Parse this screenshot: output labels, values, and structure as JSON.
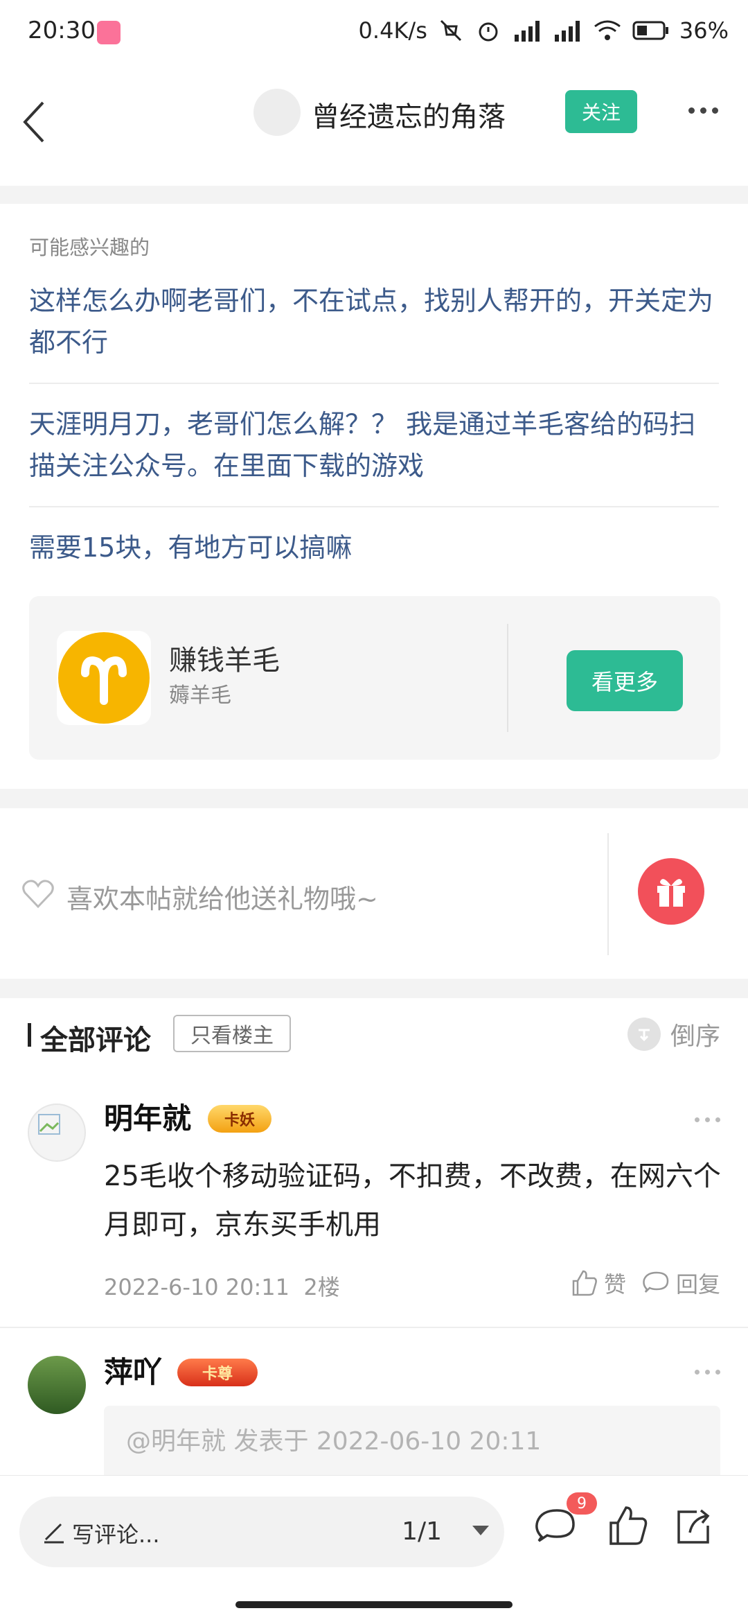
{
  "status_bar": {
    "time": "20:30",
    "net_speed": "0.4K/s",
    "battery": "36%",
    "icons": [
      "bilibili-app-icon",
      "mute-icon",
      "alarm-icon",
      "hd-signal-icon",
      "signal-icon",
      "wifi-icon",
      "battery-icon"
    ]
  },
  "header": {
    "title": "曾经遗忘的角落",
    "follow_label": "关注"
  },
  "interest": {
    "label": "可能感兴趣的",
    "items": [
      "这样怎么办啊老哥们，不在试点，找别人帮开的，开关定为都不行",
      "天涯明月刀，老哥们怎么解？？ 我是通过羊毛客给的码扫描关注公众号。在里面下载的游戏",
      "需要15块，有地方可以搞嘛"
    ],
    "game_card": {
      "name": "赚钱羊毛",
      "subtitle": "薅羊毛",
      "button": "看更多",
      "icon_color": "#f7b500"
    }
  },
  "gift": {
    "text": "喜欢本帖就给他送礼物哦~",
    "button_color": "#f2505a"
  },
  "comments_header": {
    "title": "全部评论",
    "filter": "只看楼主",
    "sort": "倒序"
  },
  "comments": [
    {
      "name": "明年就",
      "badge": "卡妖",
      "text": "25毛收个移动验证码，不扣费，不改费，在网六个月即可，京东买手机用",
      "date": "2022-6-10 20:11",
      "floor": "2楼",
      "like_label": "赞",
      "reply_label": "回复"
    },
    {
      "name": "萍吖",
      "badge": "卡尊",
      "quote": "@明年就 发表于 2022-06-10 20:11"
    }
  ],
  "bottom_bar": {
    "write_placeholder": "写评论...",
    "page": "1/1",
    "comment_count": "9"
  },
  "colors": {
    "accent_green": "#2dbb94",
    "link_blue": "#3c5a8a",
    "badge_red": "#f35a5a"
  }
}
